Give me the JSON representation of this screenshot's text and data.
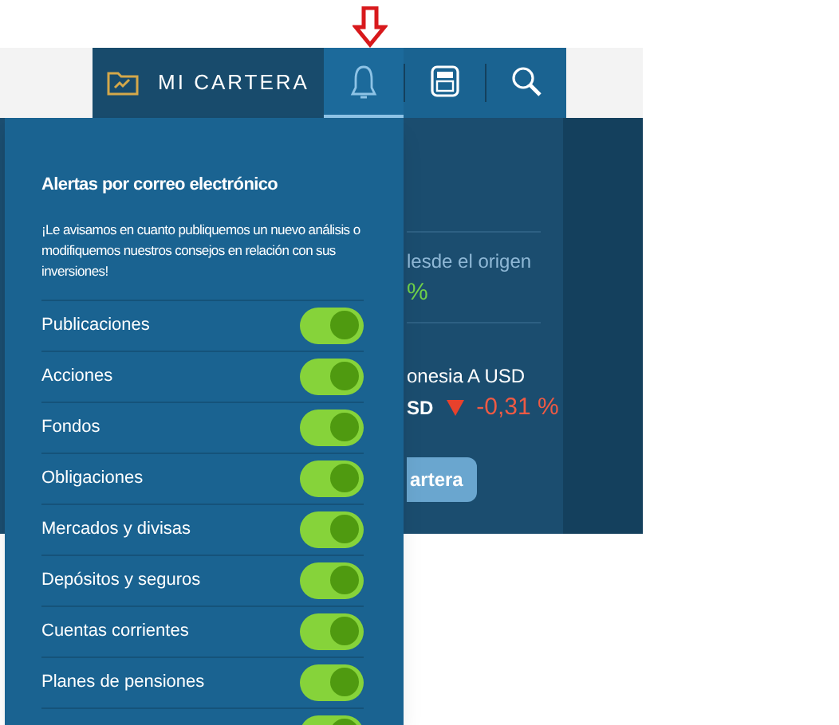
{
  "nav": {
    "portfolio_label": "MI CARTERA",
    "tabs": [
      {
        "kind": "bell",
        "selected": true
      },
      {
        "kind": "calculator",
        "selected": false
      },
      {
        "kind": "search",
        "selected": false
      }
    ]
  },
  "background_panel": {
    "return_label": "lesde el origen",
    "return_value": "%",
    "fund_name": "onesia A USD",
    "currency": "SD",
    "change": "-0,31 %",
    "button": "artera"
  },
  "alerts_dropdown": {
    "title": "Alertas por correo electrónico",
    "description": "¡Le avisamos en cuanto publiquemos un nuevo análisis o modifiquemos nuestros consejos en relación con sus inversiones!",
    "items": [
      {
        "label": "Publicaciones",
        "on": true
      },
      {
        "label": "Acciones",
        "on": true
      },
      {
        "label": "Fondos",
        "on": true
      },
      {
        "label": "Obligaciones",
        "on": true
      },
      {
        "label": "Mercados y divisas",
        "on": true
      },
      {
        "label": "Depósitos y seguros",
        "on": true
      },
      {
        "label": "Cuentas corrientes",
        "on": true
      },
      {
        "label": "Planes de pensiones",
        "on": true
      },
      {
        "on": true
      }
    ]
  }
}
